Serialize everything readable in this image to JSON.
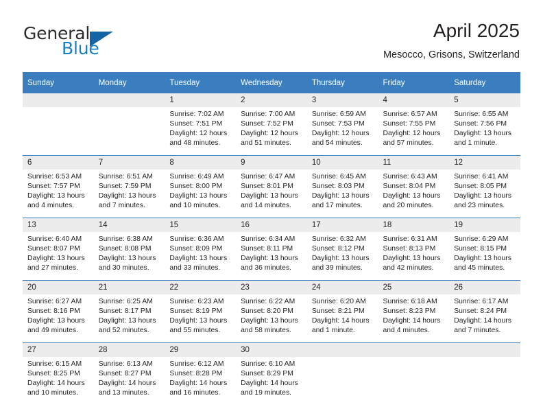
{
  "brand": {
    "name_primary": "General",
    "name_secondary": "Blue",
    "triangle_color": "#1464a5",
    "accent_color": "#3a7ebf"
  },
  "header": {
    "title": "April 2025",
    "location": "Mesocco, Grisons, Switzerland"
  },
  "calendar": {
    "weekday_headers": [
      "Sunday",
      "Monday",
      "Tuesday",
      "Wednesday",
      "Thursday",
      "Friday",
      "Saturday"
    ],
    "labels": {
      "sunrise_prefix": "Sunrise:",
      "sunset_prefix": "Sunset:",
      "daylight_prefix": "Daylight:"
    },
    "weeks": [
      [
        {
          "day": "",
          "blank": true
        },
        {
          "day": "",
          "blank": true
        },
        {
          "day": "1",
          "sunrise": "Sunrise: 7:02 AM",
          "sunset": "Sunset: 7:51 PM",
          "daylight_l1": "Daylight: 12 hours",
          "daylight_l2": "and 48 minutes."
        },
        {
          "day": "2",
          "sunrise": "Sunrise: 7:00 AM",
          "sunset": "Sunset: 7:52 PM",
          "daylight_l1": "Daylight: 12 hours",
          "daylight_l2": "and 51 minutes."
        },
        {
          "day": "3",
          "sunrise": "Sunrise: 6:59 AM",
          "sunset": "Sunset: 7:53 PM",
          "daylight_l1": "Daylight: 12 hours",
          "daylight_l2": "and 54 minutes."
        },
        {
          "day": "4",
          "sunrise": "Sunrise: 6:57 AM",
          "sunset": "Sunset: 7:55 PM",
          "daylight_l1": "Daylight: 12 hours",
          "daylight_l2": "and 57 minutes."
        },
        {
          "day": "5",
          "sunrise": "Sunrise: 6:55 AM",
          "sunset": "Sunset: 7:56 PM",
          "daylight_l1": "Daylight: 13 hours",
          "daylight_l2": "and 1 minute."
        }
      ],
      [
        {
          "day": "6",
          "sunrise": "Sunrise: 6:53 AM",
          "sunset": "Sunset: 7:57 PM",
          "daylight_l1": "Daylight: 13 hours",
          "daylight_l2": "and 4 minutes."
        },
        {
          "day": "7",
          "sunrise": "Sunrise: 6:51 AM",
          "sunset": "Sunset: 7:59 PM",
          "daylight_l1": "Daylight: 13 hours",
          "daylight_l2": "and 7 minutes."
        },
        {
          "day": "8",
          "sunrise": "Sunrise: 6:49 AM",
          "sunset": "Sunset: 8:00 PM",
          "daylight_l1": "Daylight: 13 hours",
          "daylight_l2": "and 10 minutes."
        },
        {
          "day": "9",
          "sunrise": "Sunrise: 6:47 AM",
          "sunset": "Sunset: 8:01 PM",
          "daylight_l1": "Daylight: 13 hours",
          "daylight_l2": "and 14 minutes."
        },
        {
          "day": "10",
          "sunrise": "Sunrise: 6:45 AM",
          "sunset": "Sunset: 8:03 PM",
          "daylight_l1": "Daylight: 13 hours",
          "daylight_l2": "and 17 minutes."
        },
        {
          "day": "11",
          "sunrise": "Sunrise: 6:43 AM",
          "sunset": "Sunset: 8:04 PM",
          "daylight_l1": "Daylight: 13 hours",
          "daylight_l2": "and 20 minutes."
        },
        {
          "day": "12",
          "sunrise": "Sunrise: 6:41 AM",
          "sunset": "Sunset: 8:05 PM",
          "daylight_l1": "Daylight: 13 hours",
          "daylight_l2": "and 23 minutes."
        }
      ],
      [
        {
          "day": "13",
          "sunrise": "Sunrise: 6:40 AM",
          "sunset": "Sunset: 8:07 PM",
          "daylight_l1": "Daylight: 13 hours",
          "daylight_l2": "and 27 minutes."
        },
        {
          "day": "14",
          "sunrise": "Sunrise: 6:38 AM",
          "sunset": "Sunset: 8:08 PM",
          "daylight_l1": "Daylight: 13 hours",
          "daylight_l2": "and 30 minutes."
        },
        {
          "day": "15",
          "sunrise": "Sunrise: 6:36 AM",
          "sunset": "Sunset: 8:09 PM",
          "daylight_l1": "Daylight: 13 hours",
          "daylight_l2": "and 33 minutes."
        },
        {
          "day": "16",
          "sunrise": "Sunrise: 6:34 AM",
          "sunset": "Sunset: 8:11 PM",
          "daylight_l1": "Daylight: 13 hours",
          "daylight_l2": "and 36 minutes."
        },
        {
          "day": "17",
          "sunrise": "Sunrise: 6:32 AM",
          "sunset": "Sunset: 8:12 PM",
          "daylight_l1": "Daylight: 13 hours",
          "daylight_l2": "and 39 minutes."
        },
        {
          "day": "18",
          "sunrise": "Sunrise: 6:31 AM",
          "sunset": "Sunset: 8:13 PM",
          "daylight_l1": "Daylight: 13 hours",
          "daylight_l2": "and 42 minutes."
        },
        {
          "day": "19",
          "sunrise": "Sunrise: 6:29 AM",
          "sunset": "Sunset: 8:15 PM",
          "daylight_l1": "Daylight: 13 hours",
          "daylight_l2": "and 45 minutes."
        }
      ],
      [
        {
          "day": "20",
          "sunrise": "Sunrise: 6:27 AM",
          "sunset": "Sunset: 8:16 PM",
          "daylight_l1": "Daylight: 13 hours",
          "daylight_l2": "and 49 minutes."
        },
        {
          "day": "21",
          "sunrise": "Sunrise: 6:25 AM",
          "sunset": "Sunset: 8:17 PM",
          "daylight_l1": "Daylight: 13 hours",
          "daylight_l2": "and 52 minutes."
        },
        {
          "day": "22",
          "sunrise": "Sunrise: 6:23 AM",
          "sunset": "Sunset: 8:19 PM",
          "daylight_l1": "Daylight: 13 hours",
          "daylight_l2": "and 55 minutes."
        },
        {
          "day": "23",
          "sunrise": "Sunrise: 6:22 AM",
          "sunset": "Sunset: 8:20 PM",
          "daylight_l1": "Daylight: 13 hours",
          "daylight_l2": "and 58 minutes."
        },
        {
          "day": "24",
          "sunrise": "Sunrise: 6:20 AM",
          "sunset": "Sunset: 8:21 PM",
          "daylight_l1": "Daylight: 14 hours",
          "daylight_l2": "and 1 minute."
        },
        {
          "day": "25",
          "sunrise": "Sunrise: 6:18 AM",
          "sunset": "Sunset: 8:23 PM",
          "daylight_l1": "Daylight: 14 hours",
          "daylight_l2": "and 4 minutes."
        },
        {
          "day": "26",
          "sunrise": "Sunrise: 6:17 AM",
          "sunset": "Sunset: 8:24 PM",
          "daylight_l1": "Daylight: 14 hours",
          "daylight_l2": "and 7 minutes."
        }
      ],
      [
        {
          "day": "27",
          "sunrise": "Sunrise: 6:15 AM",
          "sunset": "Sunset: 8:25 PM",
          "daylight_l1": "Daylight: 14 hours",
          "daylight_l2": "and 10 minutes."
        },
        {
          "day": "28",
          "sunrise": "Sunrise: 6:13 AM",
          "sunset": "Sunset: 8:27 PM",
          "daylight_l1": "Daylight: 14 hours",
          "daylight_l2": "and 13 minutes."
        },
        {
          "day": "29",
          "sunrise": "Sunrise: 6:12 AM",
          "sunset": "Sunset: 8:28 PM",
          "daylight_l1": "Daylight: 14 hours",
          "daylight_l2": "and 16 minutes."
        },
        {
          "day": "30",
          "sunrise": "Sunrise: 6:10 AM",
          "sunset": "Sunset: 8:29 PM",
          "daylight_l1": "Daylight: 14 hours",
          "daylight_l2": "and 19 minutes."
        },
        {
          "day": "",
          "blank": true
        },
        {
          "day": "",
          "blank": true
        },
        {
          "day": "",
          "blank": true
        }
      ]
    ]
  }
}
